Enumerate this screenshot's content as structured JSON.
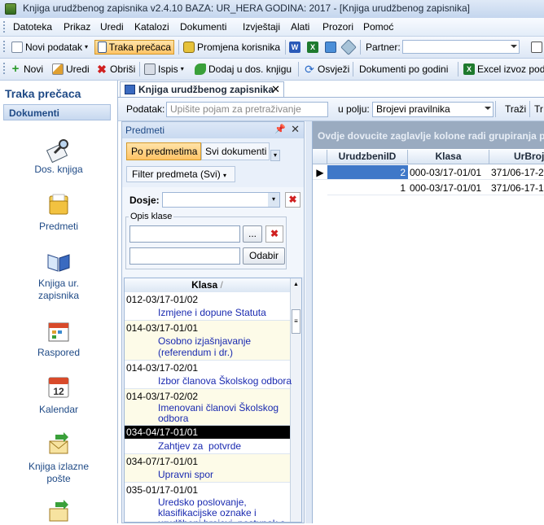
{
  "window": {
    "title": "Knjiga urudžbenog zapisnika v2.4.10     BAZA: UR_HERA     GODINA: 2017 - [Knjiga urudžbenog zapisnika]"
  },
  "menu": [
    "Datoteka",
    "Prikaz",
    "Uredi",
    "Katalozi",
    "Dokumenti",
    "Izvještaji",
    "Alati",
    "Prozori",
    "Pomoć"
  ],
  "toolbar1": {
    "new_doc": "Novi podatak",
    "shortcut_bar": "Traka prečaca",
    "change_user": "Promjena korisnika",
    "partner_label": "Partner:",
    "partner_value": ""
  },
  "toolbar2": {
    "new": "Novi",
    "edit": "Uredi",
    "delete": "Obriši",
    "print": "Ispis",
    "add_to_file": "Dodaj u dos. knjigu",
    "refresh": "Osvježi",
    "docs_by_year": "Dokumenti po godini",
    "excel": "Excel izvoz poda"
  },
  "left_panel": {
    "title": "Traka prečaca",
    "section": "Dokumenti",
    "items": [
      {
        "label": "Dos. knjiga",
        "icon": "book-magnifier-icon"
      },
      {
        "label": "Predmeti",
        "icon": "folder-icon"
      },
      {
        "label": "Knjiga ur. zapisnika",
        "icon": "open-book-icon"
      },
      {
        "label": "Raspored",
        "icon": "calendar-schedule-icon"
      },
      {
        "label": "Kalendar",
        "icon": "calendar-12-icon"
      },
      {
        "label": "Knjiga izlazne pošte",
        "icon": "outgoing-mail-icon"
      }
    ]
  },
  "doc_tab": {
    "label": "Knjiga urudžbenog zapisnika"
  },
  "search": {
    "label": "Podatak:",
    "placeholder": "Upišite pojam za pretraživanje",
    "field_label": "u polju:",
    "field_value": "Brojevi pravilnika",
    "search_button": "Traži",
    "trailing_button": "Tr"
  },
  "predmeti": {
    "title": "Predmeti",
    "tab_active": "Po predmetima",
    "tab_other": "Svi dokumenti",
    "filter": "Filter predmeta (Svi)",
    "dosje_label": "Dosje:",
    "dosje_value": "",
    "opis_label": "Opis klase",
    "odabir": "Odabir",
    "browse": "...",
    "list_header": "Klasa",
    "rows": [
      {
        "code": "012-03/17-01/02",
        "desc": "Izmjene i dopune Statuta"
      },
      {
        "code": "014-03/17-01/01",
        "desc": "Osobno izjašnjavanje (referendum i dr.)"
      },
      {
        "code": "014-03/17-02/01",
        "desc": "Izbor članova Školskog odbora"
      },
      {
        "code": "014-03/17-02/02",
        "desc": "Imenovani članovi Školskog odbora"
      },
      {
        "code": "034-04/17-01/01",
        "desc": "Zahtjev za  potvrde"
      },
      {
        "code": "034-07/17-01/01",
        "desc": "Upravni spor"
      },
      {
        "code": "035-01/17-01/01",
        "desc": "Uredsko poslovanje, klasifikacijske oznake i urudžbeni brojevi, postupak s aktima, oblik,"
      }
    ]
  },
  "grid": {
    "group_hint": "Ovdje dovucite zaglavlje kolone radi grupiranja po",
    "columns": [
      "UrudzbeniID",
      "Klasa",
      "UrBroj"
    ],
    "rows": [
      {
        "id": "2",
        "klasa": "000-03/17-01/01",
        "urbroj": "371/06-17-2"
      },
      {
        "id": "1",
        "klasa": "000-03/17-01/01",
        "urbroj": "371/06-17-1"
      }
    ]
  },
  "colors": {
    "accent": "#1f4a86",
    "highlight": "#ffc466",
    "selection": "#000000"
  }
}
